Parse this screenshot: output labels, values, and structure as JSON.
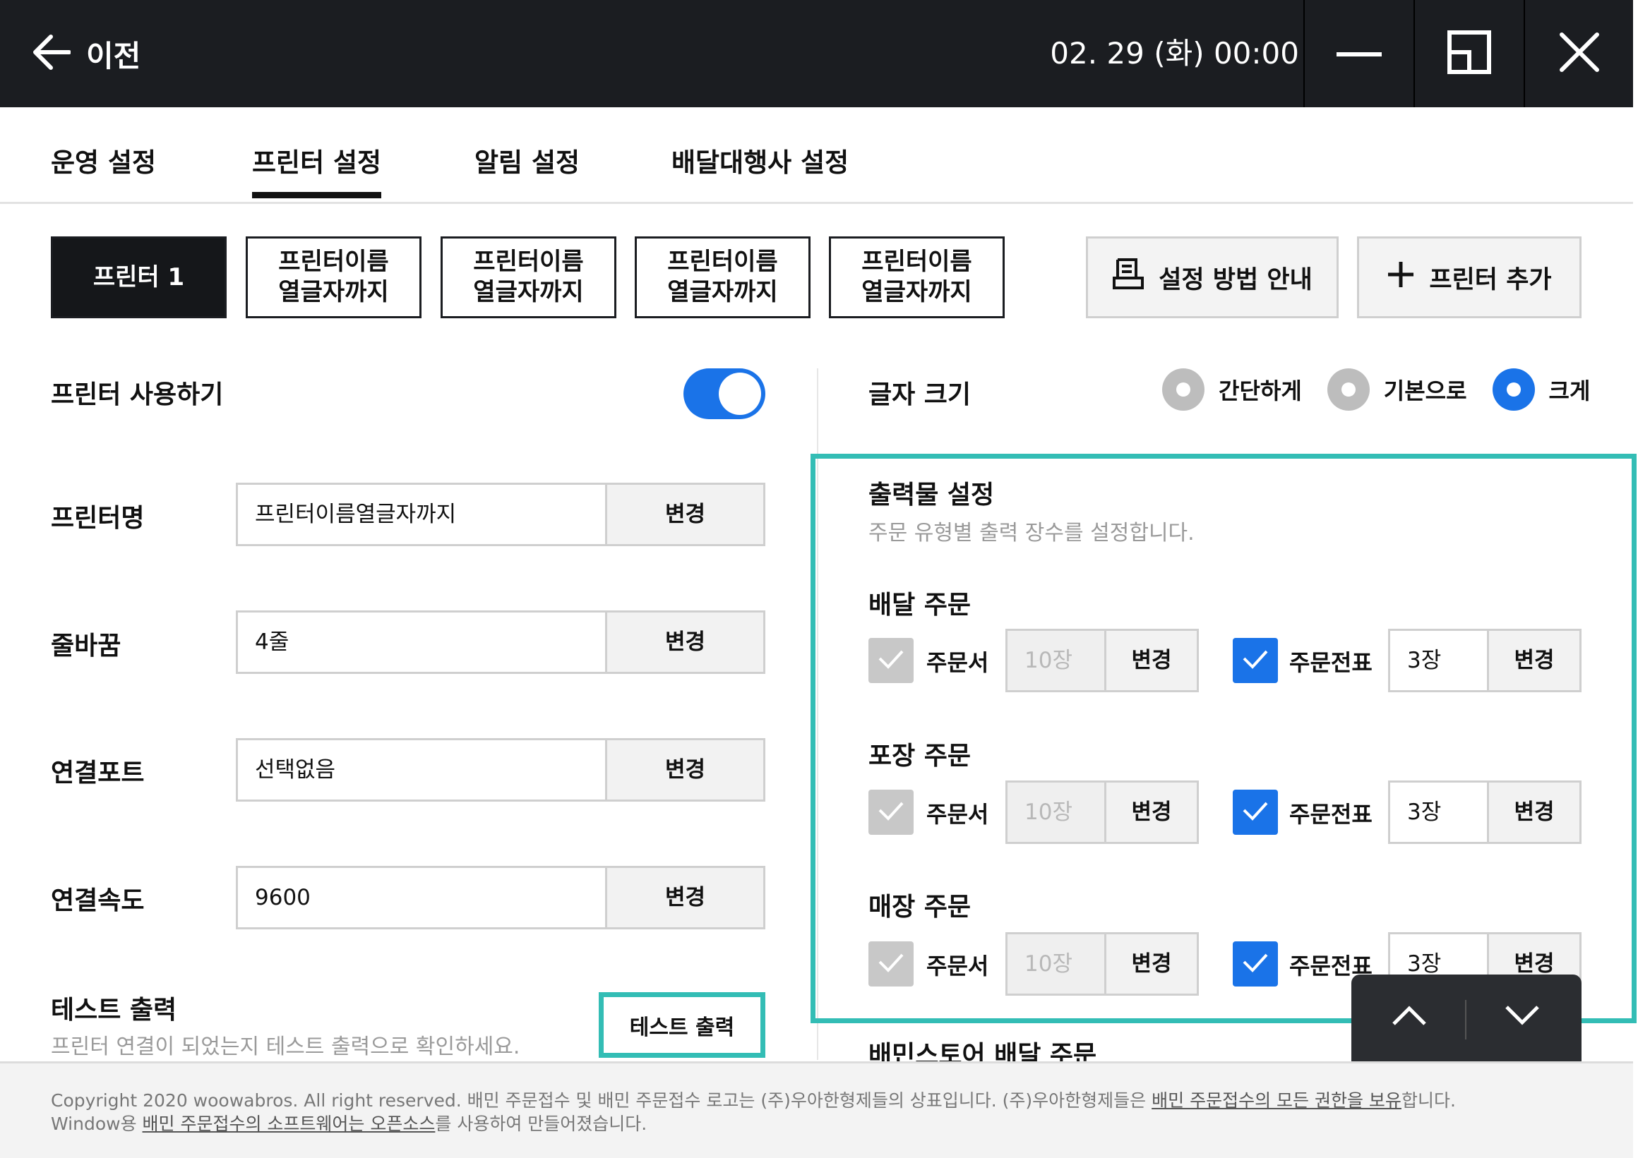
{
  "titlebar": {
    "back_label": "이전",
    "datetime": "02. 29 (화) 00:00"
  },
  "tabs": [
    "운영 설정",
    "프린터 설정",
    "알림 설정",
    "배달대행사 설정"
  ],
  "printers": {
    "active": "프린터 1",
    "others": [
      "프린터이름\n열글자까지",
      "프린터이름\n열글자까지",
      "프린터이름\n열글자까지",
      "프린터이름\n열글자까지"
    ],
    "guide_label": "설정 방법 안내",
    "add_label": "프린터 추가"
  },
  "left": {
    "use_printer_label": "프린터 사용하기",
    "use_printer_on": true,
    "fields": [
      {
        "label": "프린터명",
        "value": "프린터이름열글자까지",
        "button": "변경"
      },
      {
        "label": "줄바꿈",
        "value": "4줄",
        "button": "변경"
      },
      {
        "label": "연결포트",
        "value": "선택없음",
        "button": "변경"
      },
      {
        "label": "연결속도",
        "value": "9600",
        "button": "변경"
      }
    ],
    "test_title": "테스트 출력",
    "test_desc": "프린터 연결이 되었는지 테스트 출력으로 확인하세요.",
    "test_button": "테스트 출력"
  },
  "right": {
    "font_size_label": "글자 크기",
    "font_size_options": [
      "간단하게",
      "기본으로",
      "크게"
    ],
    "font_size_selected": "크게",
    "output_title": "출력물 설정",
    "output_desc": "주문 유형별 출력 장수를 설정합니다.",
    "orders": [
      {
        "title": "배달 주문",
        "receipt_label": "주문서",
        "receipt_value": "10장",
        "ticket_label": "주문전표",
        "ticket_value": "3장",
        "button": "변경"
      },
      {
        "title": "포장 주문",
        "receipt_label": "주문서",
        "receipt_value": "10장",
        "ticket_label": "주문전표",
        "ticket_value": "3장",
        "button": "변경"
      },
      {
        "title": "매장 주문",
        "receipt_label": "주문서",
        "receipt_value": "10장",
        "ticket_label": "주문전표",
        "ticket_value": "3장",
        "button": "변경"
      }
    ],
    "next_section_title": "배민스토어 배달 주문"
  },
  "footer": {
    "line1_a": "Copyright 2020 woowabros. All right reserved. 배민 주문접수 및 배민 주문접수 로고는 (주)우아한형제들의 상표입니다. (주)우아한형제들은 ",
    "line1_link": "배민 주문접수의 모든 권한을 보유",
    "line1_b": "합니다.",
    "line2_a": "Window용 ",
    "line2_link": "배민 주문접수의 소프트웨어는 오픈소스",
    "line2_b": "를 사용하여 만들어졌습니다."
  },
  "colors": {
    "accent_blue": "#1a73e8",
    "highlight_teal": "#33bdb5",
    "titlebar_bg": "#1b1d21"
  }
}
